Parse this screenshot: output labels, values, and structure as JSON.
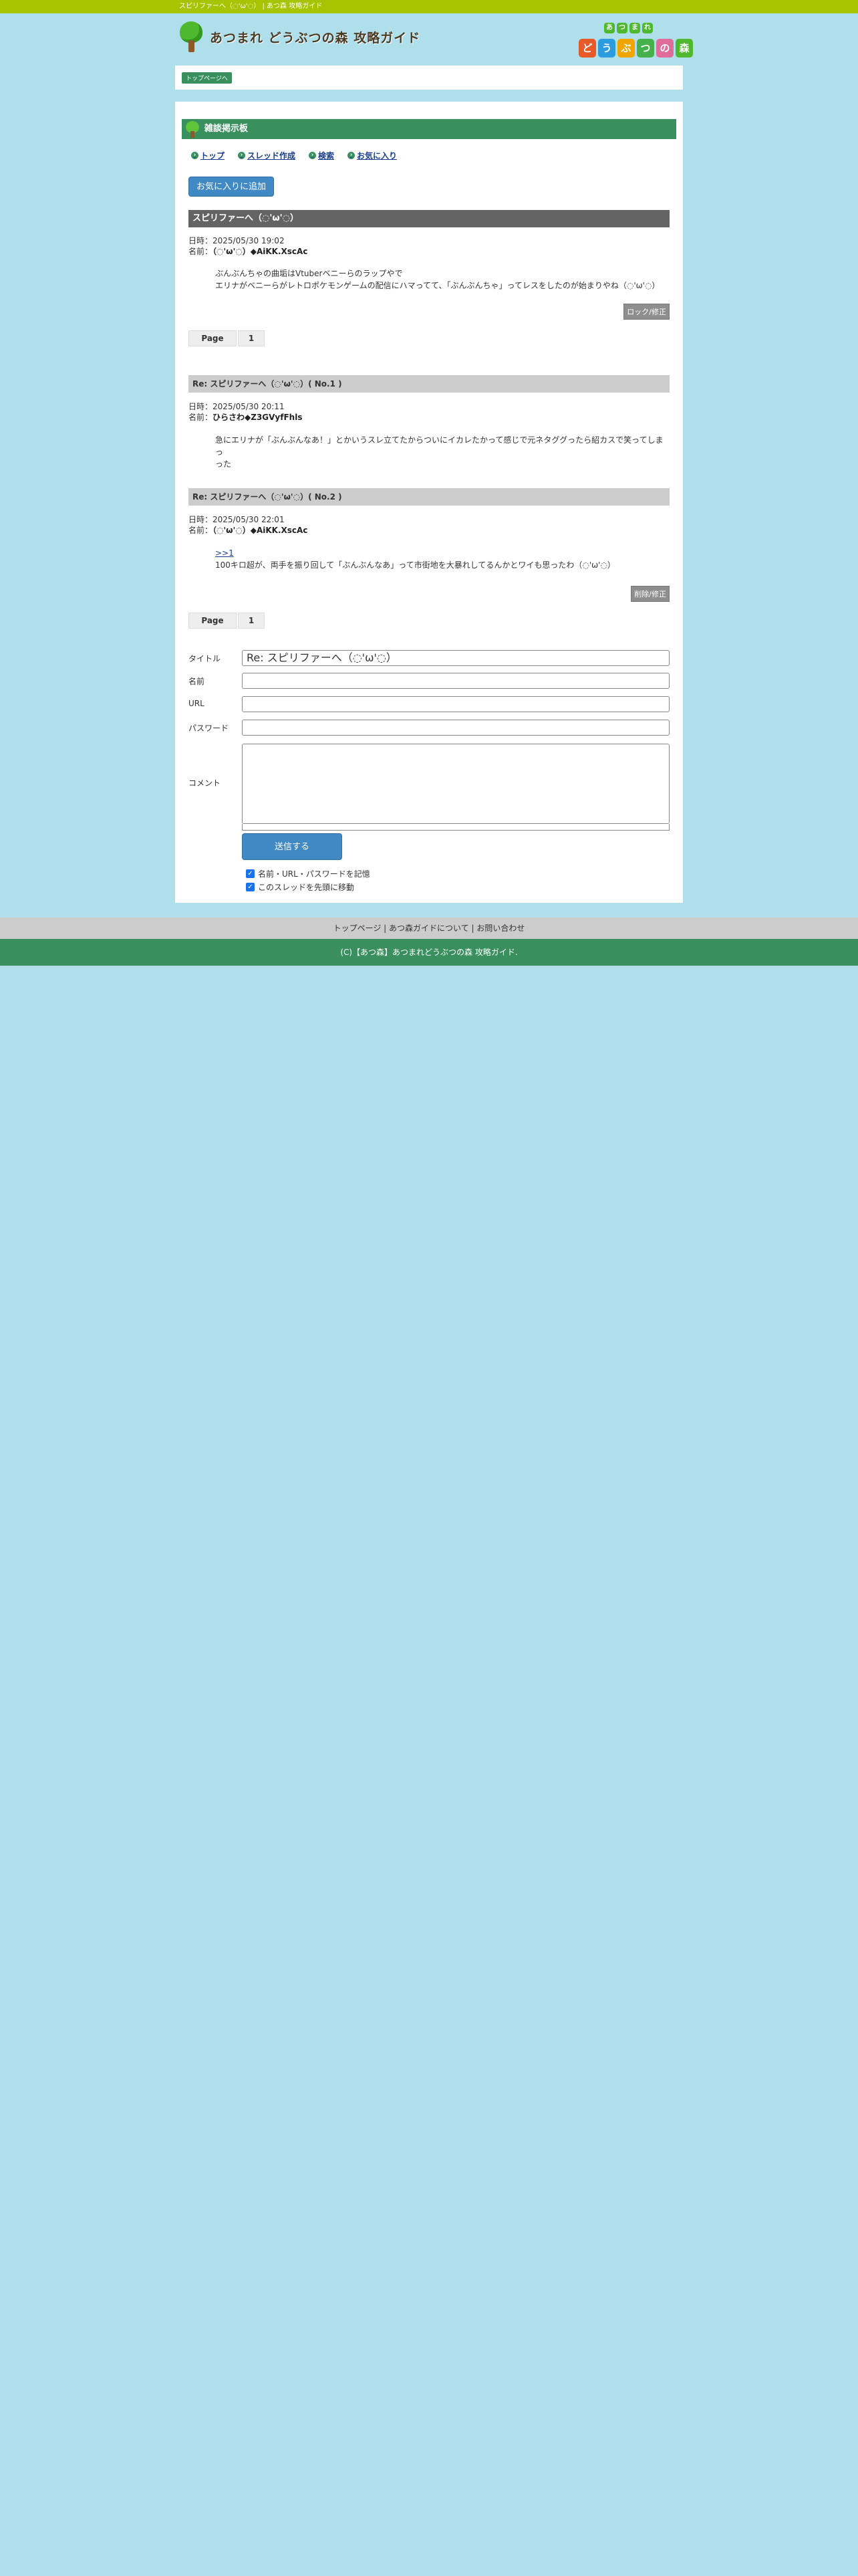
{
  "topbar": {
    "text": "スピリファーへ（◌'ω'◌） | あつ森 攻略ガイド"
  },
  "header": {
    "logo_text": "あつまれ どうぶつの森 攻略ガイド",
    "brand_small": [
      "あ",
      "つ",
      "ま",
      "れ"
    ],
    "brand_big": [
      "ど",
      "う",
      "ぶ",
      "つ",
      "の",
      "森"
    ],
    "brand_colors": [
      "#e85a2a",
      "#2d9be0",
      "#f0a500",
      "#46b04a",
      "#e06c9a",
      "#4eb82f"
    ]
  },
  "breadcrumb": {
    "label": "トップページへ"
  },
  "board": {
    "title": "雑談掲示板"
  },
  "nav": [
    {
      "label": "トップ"
    },
    {
      "label": "スレッド作成"
    },
    {
      "label": "検索"
    },
    {
      "label": "お気に入り"
    }
  ],
  "favorite_button": "お気に入りに追加",
  "thread": {
    "title": "スピリファーへ（◌'ω'◌）",
    "date_label": "日時：",
    "date": "2025/05/30 19:02",
    "name_label": "名前：",
    "name": "（◌'ω'◌）◆AiKK.XscAc",
    "body_line1": "ぶんぶんちゃの曲垢はVtuberベニーらのラップやで",
    "body_line2": "エリナがベニーらがレトロポケモンゲームの配信にハマってて、「ぶんぶんちゃ」ってレスをしたのが始まりやね（◌'ω'◌）",
    "lock_button": "ロック/修正"
  },
  "pager": {
    "label": "Page",
    "current": "1"
  },
  "replies": [
    {
      "title": "Re: スピリファーへ（◌'ω'◌）( No.1 )",
      "date": "2025/05/30 20:11",
      "name": "ひらさわ◆Z3GVyfFhls",
      "body_line1": "急にエリナが「ぶんぶんなあ！」とかいうスレ立てたからついにイカレたかって感じで元ネタググったら紹カスで笑ってしまっ",
      "body_line2": "った"
    },
    {
      "title": "Re: スピリファーへ（◌'ω'◌）( No.2 )",
      "date": "2025/05/30 22:01",
      "name": "（◌'ω'◌）◆AiKK.XscAc",
      "anchor": ">>1",
      "body_line1": "100キロ超が、両手を振り回して「ぶんぶんなあ」って市街地を大暴れしてるんかとワイも思ったわ（◌'ω'◌）",
      "edit_button": "削除/修正"
    }
  ],
  "form": {
    "title_label": "タイトル",
    "title_value": "Re: スピリファーへ（◌'ω'◌）",
    "name_label": "名前",
    "url_label": "URL",
    "password_label": "パスワード",
    "comment_label": "コメント",
    "submit_label": "送信する",
    "remember_label": "名前・URL・パスワードを記憶",
    "move_top_label": "このスレッドを先頭に移動"
  },
  "footer": {
    "link1": "トップページ",
    "sep": "|",
    "link2": "あつ森ガイドについて",
    "link3": "お問い合わせ",
    "copyright": "(C)【あつ森】あつまれどうぶつの森 攻略ガイド."
  }
}
